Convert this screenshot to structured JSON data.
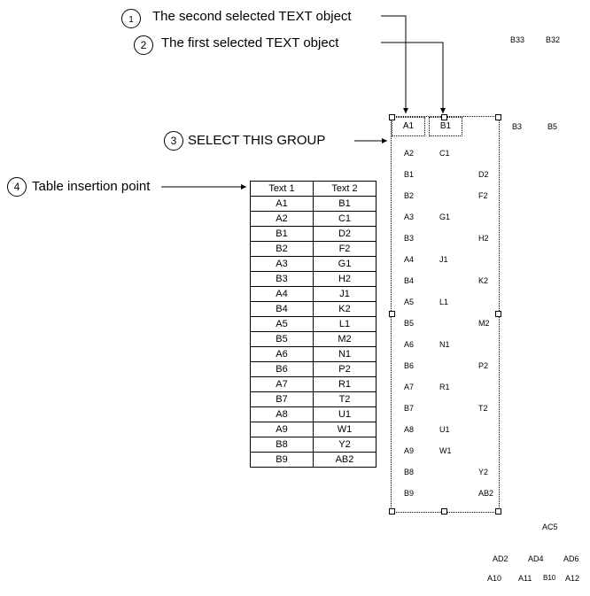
{
  "callouts": {
    "c1": {
      "num": "1",
      "label": "The second selected TEXT object"
    },
    "c2": {
      "num": "2",
      "label": "The first selected TEXT object"
    },
    "c3": {
      "num": "3",
      "label": "SELECT THIS GROUP"
    },
    "c4": {
      "num": "4",
      "label": "Table insertion point"
    }
  },
  "selection": {
    "box1": "A1",
    "box2": "B1"
  },
  "table": {
    "headers": [
      "Text 1",
      "Text 2"
    ],
    "rows": [
      [
        "A1",
        "B1"
      ],
      [
        "A2",
        "C1"
      ],
      [
        "B1",
        "D2"
      ],
      [
        "B2",
        "F2"
      ],
      [
        "A3",
        "G1"
      ],
      [
        "B3",
        "H2"
      ],
      [
        "A4",
        "J1"
      ],
      [
        "B4",
        "K2"
      ],
      [
        "A5",
        "L1"
      ],
      [
        "B5",
        "M2"
      ],
      [
        "A6",
        "N1"
      ],
      [
        "B6",
        "P2"
      ],
      [
        "A7",
        "R1"
      ],
      [
        "B7",
        "T2"
      ],
      [
        "A8",
        "U1"
      ],
      [
        "A9",
        "W1"
      ],
      [
        "B8",
        "Y2"
      ],
      [
        "B9",
        "AB2"
      ]
    ]
  },
  "scatter": {
    "in_group_col1": [
      "A2",
      "B1",
      "B2",
      "A3",
      "B3",
      "A4",
      "B4",
      "A5",
      "B5",
      "A6",
      "B6",
      "A7",
      "B7",
      "A8",
      "A9",
      "B8",
      "B9"
    ],
    "in_group_col2_pairs": [
      [
        "A2",
        "C1"
      ],
      [
        "B1",
        "D2"
      ],
      [
        "B2",
        "F2"
      ],
      [
        "A3",
        "G1"
      ],
      [
        "B3",
        "H2"
      ],
      [
        "A4",
        "J1"
      ],
      [
        "B4",
        "K2"
      ],
      [
        "A5",
        "L1"
      ],
      [
        "B5",
        "M2"
      ],
      [
        "A6",
        "N1"
      ],
      [
        "B6",
        "P2"
      ],
      [
        "A7",
        "R1"
      ],
      [
        "B7",
        "T2"
      ],
      [
        "A8",
        "U1"
      ],
      [
        "A9",
        "W1"
      ],
      [
        "B8",
        "Y2"
      ],
      [
        "B9",
        "AB2"
      ]
    ],
    "outside_right_top": [
      "B33",
      "B32"
    ],
    "outside_right_mid": [
      "B3",
      "B5"
    ],
    "outside_bottom1": "AC5",
    "outside_bottom2": [
      "AD2",
      "AD4",
      "AD6"
    ],
    "outside_bottom3": [
      "A10",
      "A11",
      "B10",
      "A12"
    ]
  }
}
